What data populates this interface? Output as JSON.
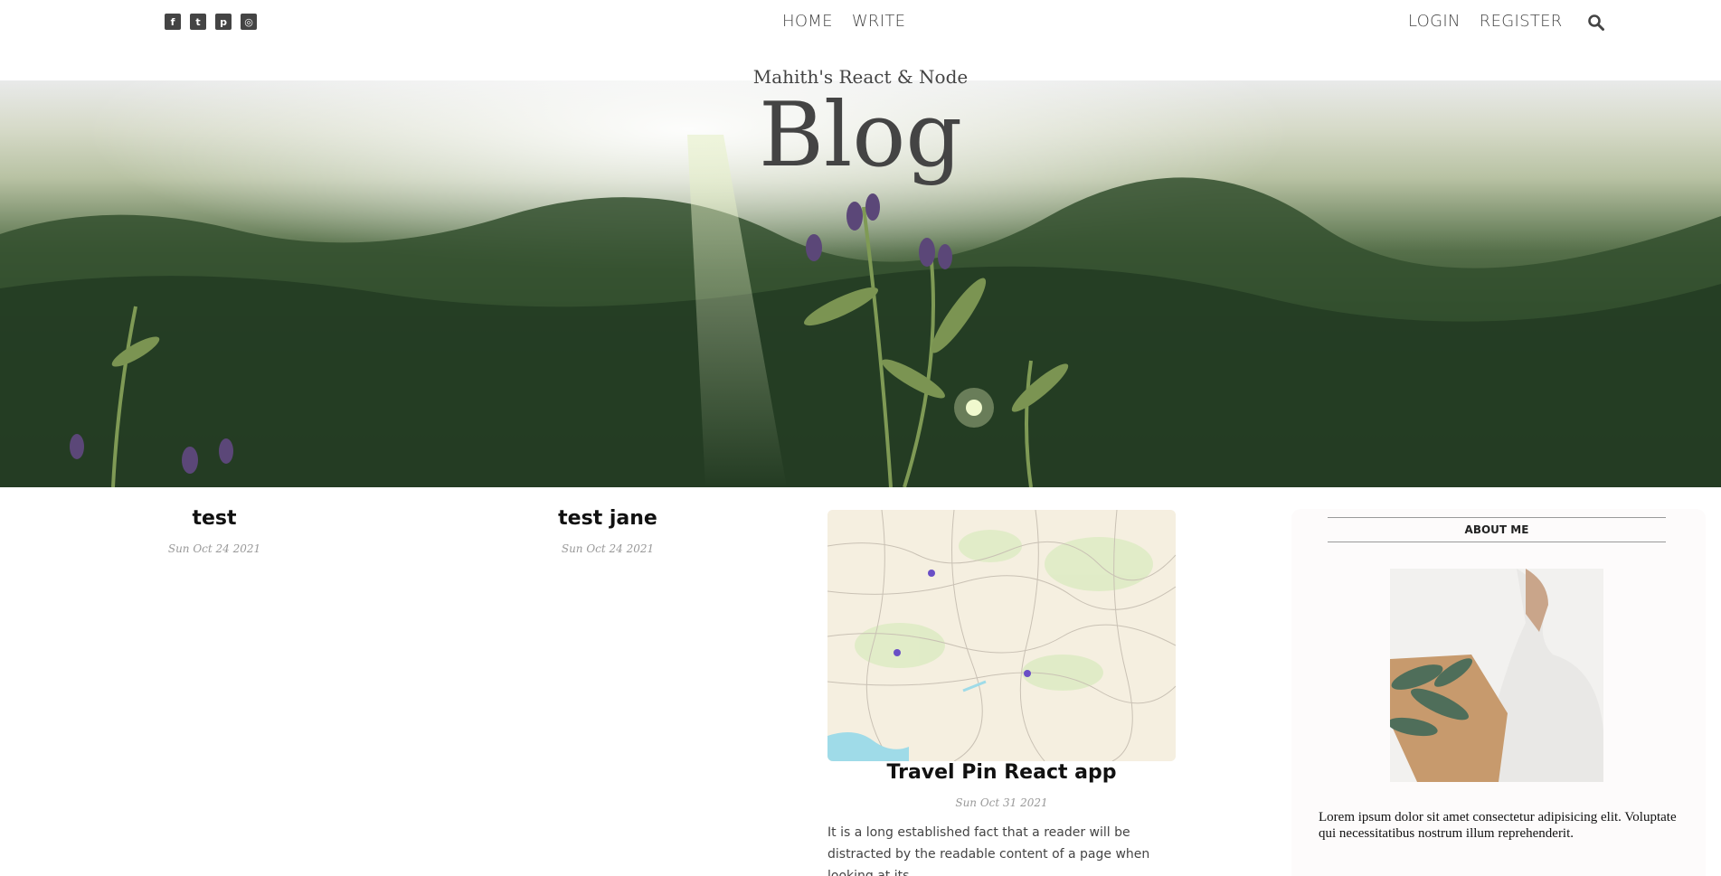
{
  "social": {
    "facebook": {
      "icon": "facebook-icon",
      "glyph": "f"
    },
    "twitter": {
      "icon": "twitter-icon",
      "glyph": "t"
    },
    "pinterest": {
      "icon": "pinterest-icon",
      "glyph": "p"
    },
    "instagram": {
      "icon": "instagram-icon",
      "glyph": "◎"
    }
  },
  "nav": {
    "center": [
      "HOME",
      "WRITE"
    ],
    "right": [
      "LOGIN",
      "REGISTER"
    ]
  },
  "header": {
    "subtitle": "Mahith's React & Node",
    "title": "Blog"
  },
  "posts": [
    {
      "title": "test",
      "date": "Sun Oct 24 2021"
    },
    {
      "title": "test jane",
      "date": "Sun Oct 24 2021"
    },
    {
      "title": "Travel Pin React app",
      "date": "Sun Oct 31 2021",
      "desc": "It is a long established fact that a reader will be distracted by the readable content of a page when looking at its"
    }
  ],
  "sidebar": {
    "title": "ABOUT ME",
    "text": "Lorem ipsum dolor sit amet consectetur adipisicing elit. Voluptate qui necessitatibus nostrum illum reprehenderit."
  },
  "colors": {
    "text": "#444444",
    "accent_pin": "#6a4fc6"
  }
}
